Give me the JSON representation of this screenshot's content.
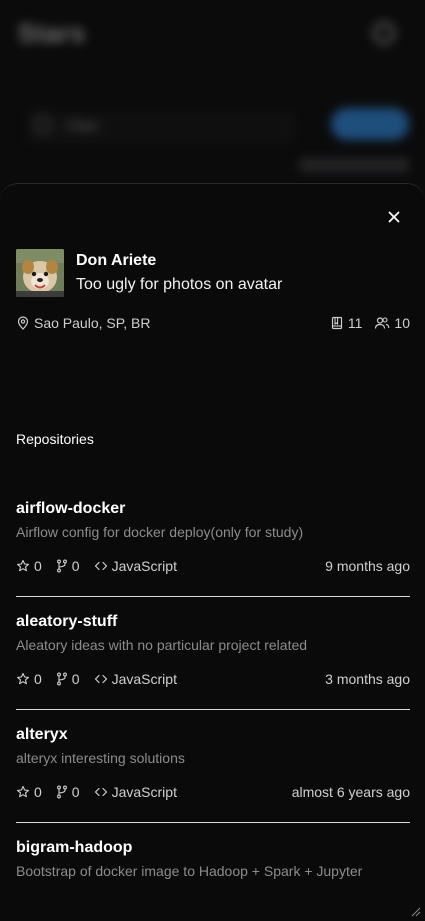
{
  "background": {
    "app_title": "Stars",
    "search_icon": "search-icon",
    "search_label": "Filter",
    "action_label": "",
    "meta_text": ""
  },
  "profile": {
    "name": "Don Ariete",
    "bio": "Too ugly for photos on avatar",
    "location": "Sao Paulo, SP, BR",
    "repos_count": "11",
    "followers_count": "10"
  },
  "repositories_title": "Repositories",
  "repos": [
    {
      "name": "airflow-docker",
      "description": "Airflow config for docker deploy(only for study)",
      "stars": "0",
      "forks": "0",
      "language": "JavaScript",
      "updated": "9 months ago"
    },
    {
      "name": "aleatory-stuff",
      "description": "Aleatory ideas with no particular project related",
      "stars": "0",
      "forks": "0",
      "language": "JavaScript",
      "updated": "3 months ago"
    },
    {
      "name": "alteryx",
      "description": "alteryx interesting solutions",
      "stars": "0",
      "forks": "0",
      "language": "JavaScript",
      "updated": "almost 6 years ago"
    },
    {
      "name": "bigram-hadoop",
      "description": "Bootstrap of docker image to Hadoop + Spark + Jupyter",
      "stars": "",
      "forks": "",
      "language": "",
      "updated": ""
    }
  ],
  "colors": {
    "sheet_bg": "#0a0a0a",
    "divider": "#d9d9d9",
    "muted": "#8c8c8c",
    "accent": "#2f86d8"
  }
}
